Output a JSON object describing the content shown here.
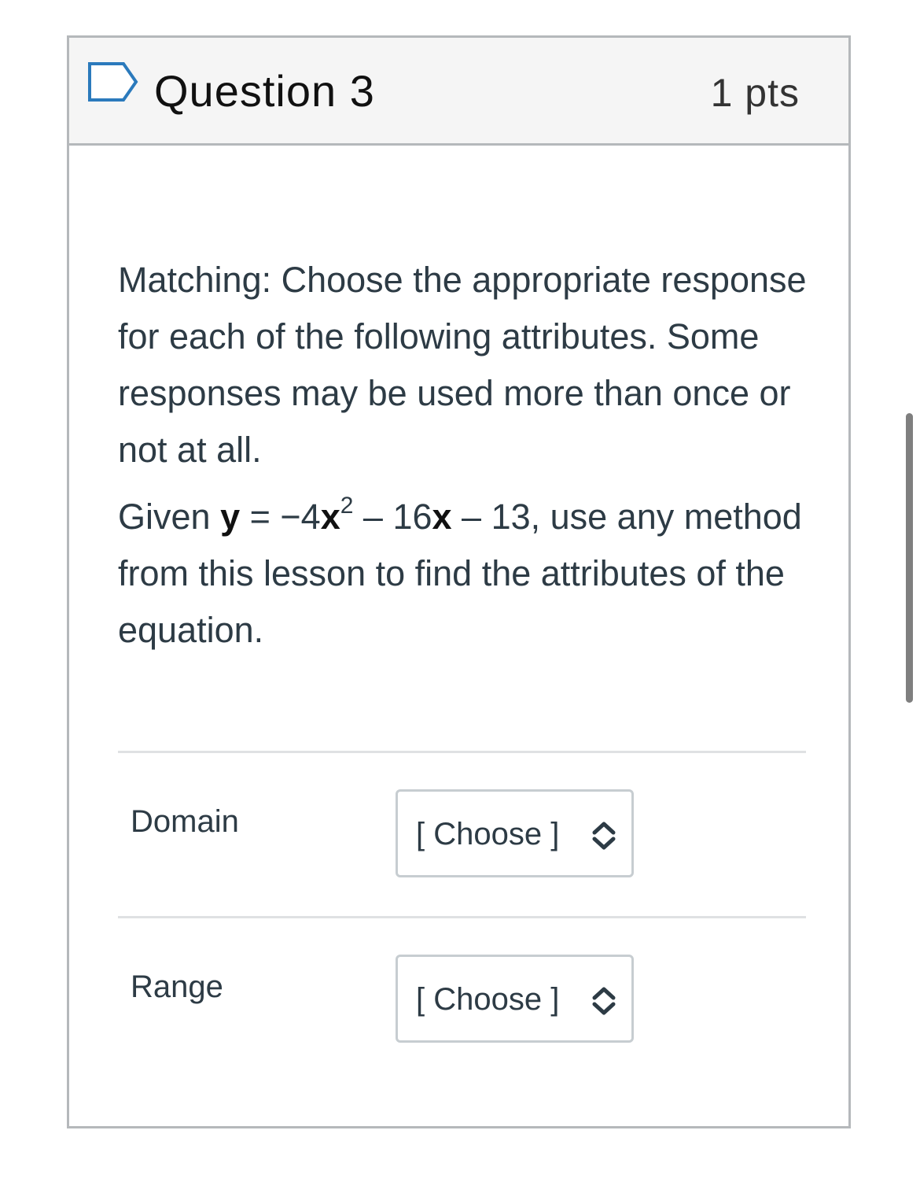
{
  "question": {
    "title": "Question 3",
    "points": "1 pts",
    "flag_icon": "flag-outline-icon"
  },
  "prompt": {
    "paragraph1": "Matching: Choose the appropriate response for each of the following attributes. Some responses may be used more than once or not at all.",
    "paragraph2": {
      "given": "Given ",
      "y_var": "y",
      "eq_part1": " = −4",
      "x_var1": "x",
      "exponent": "2",
      "eq_part2": " – 16",
      "x_var2": "x",
      "eq_part3": " – 13, use any method from this lesson to find the attributes of the equation."
    }
  },
  "matches": [
    {
      "label": "Domain",
      "selected": "[ Choose ]"
    },
    {
      "label": "Range",
      "selected": "[ Choose ]"
    }
  ],
  "colors": {
    "border": "#b5b8bb",
    "header_bg": "#f5f5f5",
    "flag": "#2b7abc",
    "text": "#2d3b45"
  }
}
